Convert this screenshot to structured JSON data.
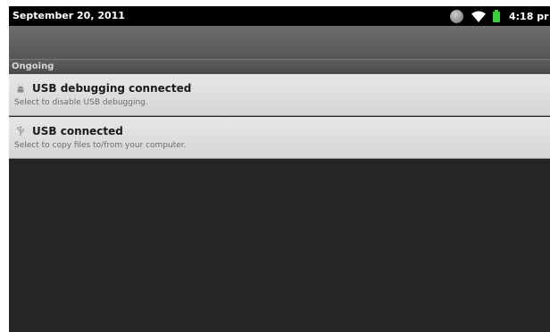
{
  "status_bar": {
    "date": "September 20, 2011",
    "time": "4:18 pr",
    "icons": [
      "sync-icon",
      "wifi-icon",
      "battery-icon"
    ],
    "battery_color": "#3bd03b"
  },
  "section": {
    "label": "Ongoing"
  },
  "notifications": [
    {
      "icon": "android-debug-icon",
      "title": "USB debugging connected",
      "subtitle": "Select to disable USB debugging."
    },
    {
      "icon": "usb-icon",
      "title": "USB connected",
      "subtitle": "Select to copy files to/from your computer."
    }
  ]
}
